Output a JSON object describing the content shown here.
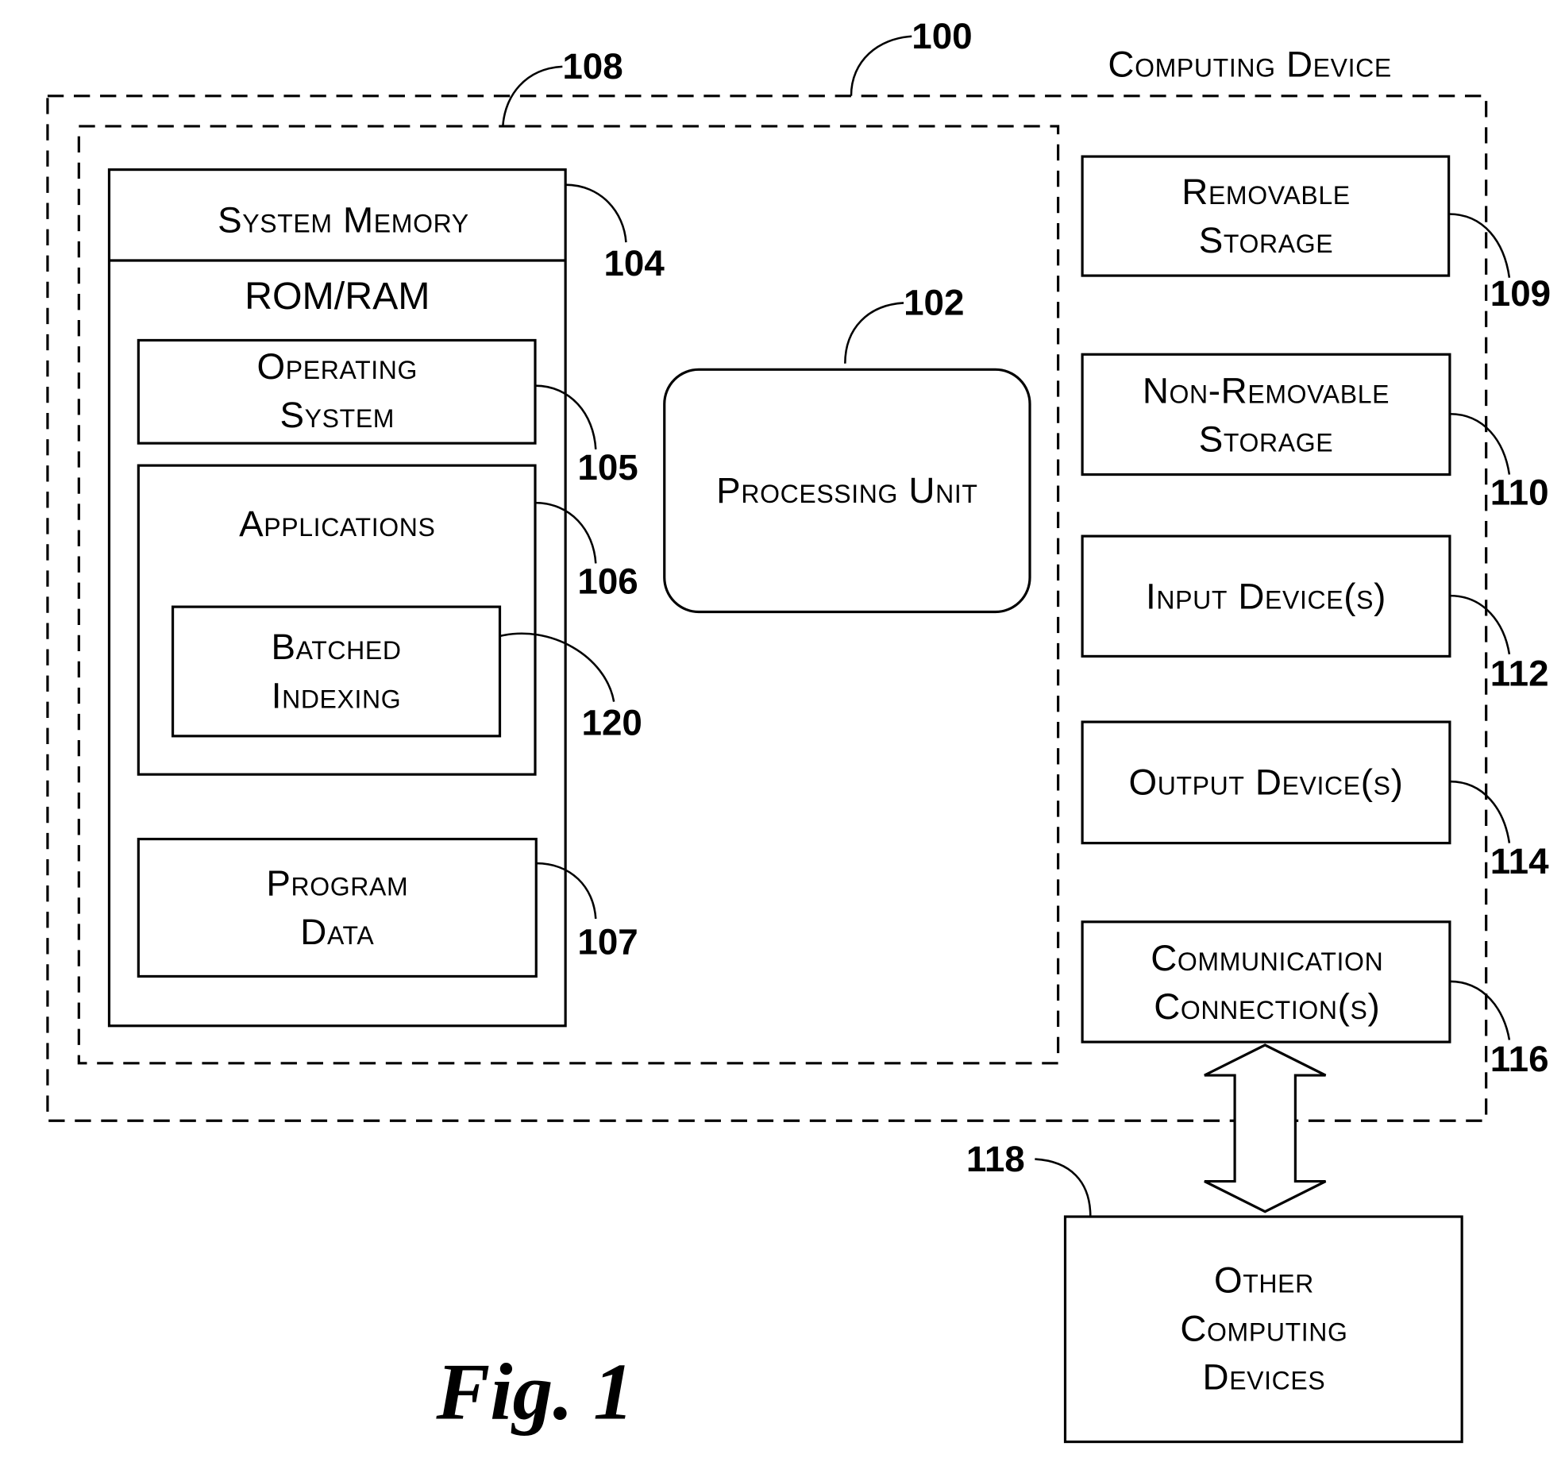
{
  "figure": {
    "caption": "Fig. 1",
    "title": "Computing Device"
  },
  "refs": {
    "computing_device": "100",
    "processing_unit": "102",
    "system_memory": "104",
    "operating_system": "105",
    "applications": "106",
    "program_data": "107",
    "basic_config": "108",
    "removable_storage": "109",
    "non_removable_storage": "110",
    "input_devices": "112",
    "output_devices": "114",
    "communication_connections": "116",
    "other_computing_devices": "118",
    "batched_indexing": "120"
  },
  "blocks": {
    "system_memory": "System Memory",
    "rom_ram": "ROM/RAM",
    "operating_system": [
      "Operating",
      "System"
    ],
    "applications": "Applications",
    "batched_indexing": [
      "Batched",
      "Indexing"
    ],
    "program_data": [
      "Program",
      "Data"
    ],
    "processing_unit": "Processing Unit",
    "removable_storage": [
      "Removable",
      "Storage"
    ],
    "non_removable_storage": [
      "Non-Removable",
      "Storage"
    ],
    "input_devices": "Input Device(s)",
    "output_devices": "Output Device(s)",
    "communication_connections": [
      "Communication",
      "Connection(s)"
    ],
    "other_computing_devices": [
      "Other",
      "Computing",
      "Devices"
    ]
  }
}
